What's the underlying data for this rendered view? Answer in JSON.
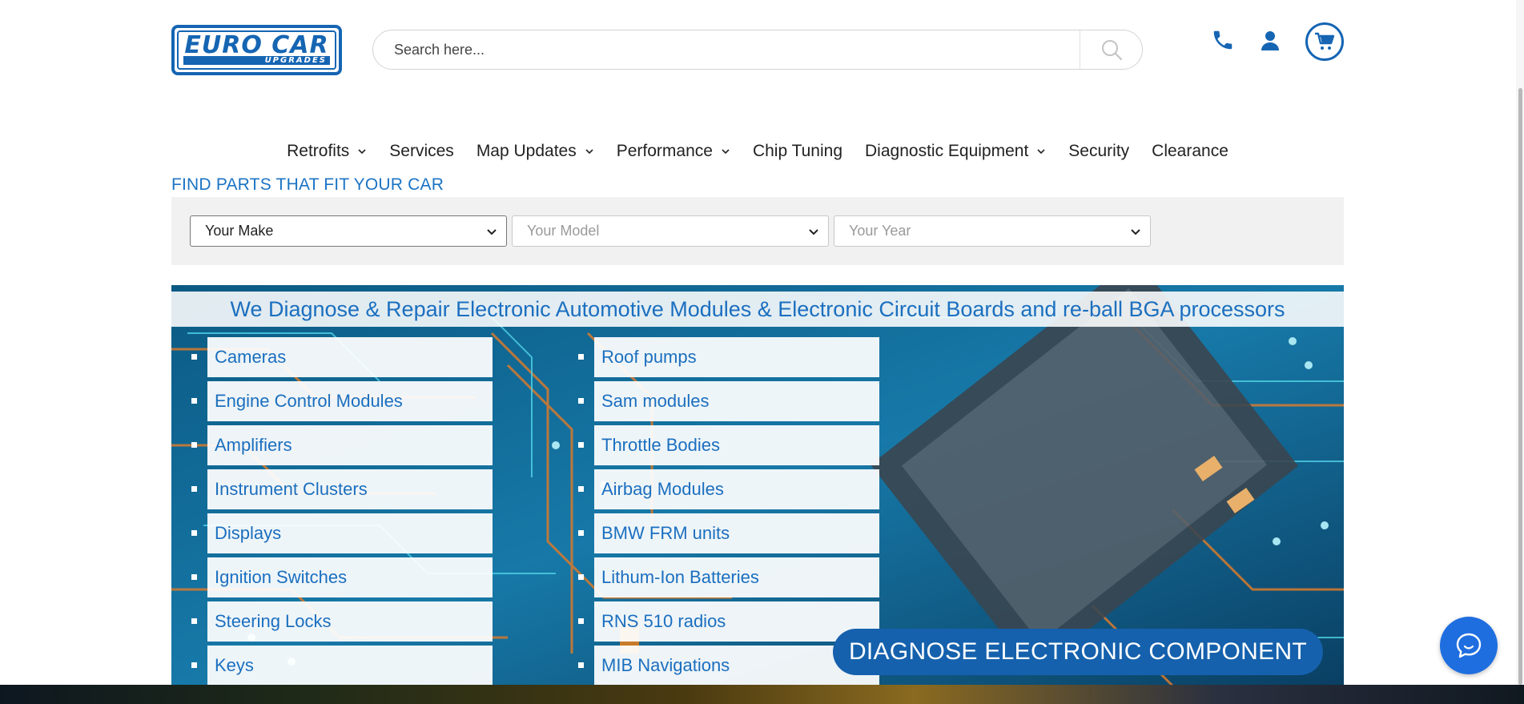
{
  "logo": {
    "main": "EURO CAR",
    "sub": "UPGRADES"
  },
  "search": {
    "placeholder": "Search here..."
  },
  "nav": [
    {
      "label": "Retrofits",
      "has_dropdown": true
    },
    {
      "label": "Services",
      "has_dropdown": false
    },
    {
      "label": "Map Updates",
      "has_dropdown": true
    },
    {
      "label": "Performance",
      "has_dropdown": true
    },
    {
      "label": "Chip Tuning",
      "has_dropdown": false
    },
    {
      "label": "Diagnostic Equipment",
      "has_dropdown": true
    },
    {
      "label": "Security",
      "has_dropdown": false
    },
    {
      "label": "Clearance",
      "has_dropdown": false
    }
  ],
  "finder": {
    "title": "FIND PARTS THAT FIT YOUR CAR",
    "make": "Your Make",
    "model": "Your Model",
    "year": "Your Year"
  },
  "banner": {
    "title": "We Diagnose & Repair Electronic Automotive Modules & Electronic Circuit Boards and re-ball BGA processors",
    "left_items": [
      "Cameras",
      "Engine Control Modules",
      "Amplifiers",
      "Instrument Clusters",
      "Displays",
      "Ignition Switches",
      "Steering Locks",
      "Keys"
    ],
    "right_items": [
      "Roof pumps",
      "Sam modules",
      "Throttle Bodies",
      "Airbag Modules",
      "BMW FRM units",
      "Lithum-Ion Batteries",
      "RNS 510 radios",
      "MIB Navigations"
    ],
    "cta": "DIAGNOSE ELECTRONIC COMPONENT"
  },
  "colors": {
    "brand": "#1565b3",
    "link": "#1b6fbf",
    "chat": "#1e6ee0"
  },
  "icons": [
    "search-icon",
    "phone-icon",
    "user-icon",
    "cart-icon",
    "chat-icon",
    "chevron-down-icon"
  ]
}
